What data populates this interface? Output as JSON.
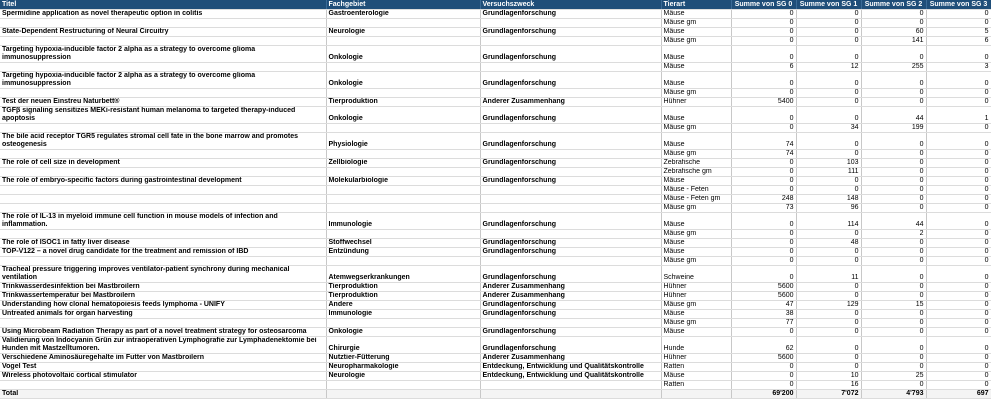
{
  "headers": [
    "Titel",
    "Fachgebiet",
    "Versuchszweck",
    "Tierart",
    "Summe von SG 0",
    "Summe von SG 1",
    "Summe von SG 2",
    "Summe von SG 3"
  ],
  "rows": [
    {
      "titel": "Spermidine application as novel therapeutic option in colitis",
      "fach": "Gastroenterologie",
      "zweck": "Grundlagenforschung",
      "tier": "Mäuse",
      "sg0": "0",
      "sg1": "0",
      "sg2": "0",
      "sg3": "0"
    },
    {
      "titel": "",
      "fach": "",
      "zweck": "",
      "tier": "Mäuse gm",
      "sg0": "0",
      "sg1": "0",
      "sg2": "0",
      "sg3": "0"
    },
    {
      "titel": "State-Dependent Restructuring of Neural Circuitry",
      "fach": "Neurologie",
      "zweck": "Grundlagenforschung",
      "tier": "Mäuse",
      "sg0": "0",
      "sg1": "0",
      "sg2": "60",
      "sg3": "5"
    },
    {
      "titel": "",
      "fach": "",
      "zweck": "",
      "tier": "Mäuse gm",
      "sg0": "0",
      "sg1": "0",
      "sg2": "141",
      "sg3": "6"
    },
    {
      "titel": "Targeting hypoxia-inducible factor 2 alpha as a strategy to overcome glioma immunosuppression",
      "fach": "Onkologie",
      "zweck": "Grundlagenforschung",
      "tier": "Mäuse",
      "sg0": "0",
      "sg1": "0",
      "sg2": "0",
      "sg3": "0"
    },
    {
      "titel": "",
      "fach": "",
      "zweck": "",
      "tier": "Mäuse",
      "sg0": "6",
      "sg1": "12",
      "sg2": "255",
      "sg3": "3"
    },
    {
      "titel": "Targeting hypoxia-inducible factor 2 alpha as a strategy to overcome glioma immunosuppression",
      "fach": "Onkologie",
      "zweck": "Grundlagenforschung",
      "tier": "Mäuse",
      "sg0": "0",
      "sg1": "0",
      "sg2": "0",
      "sg3": "0"
    },
    {
      "titel": "",
      "fach": "",
      "zweck": "",
      "tier": "Mäuse gm",
      "sg0": "0",
      "sg1": "0",
      "sg2": "0",
      "sg3": "0"
    },
    {
      "titel": "Test der neuen Einstreu Naturbett®",
      "fach": "Tierproduktion",
      "zweck": "Anderer Zusammenhang",
      "tier": "Hühner",
      "sg0": "5400",
      "sg1": "0",
      "sg2": "0",
      "sg3": "0"
    },
    {
      "titel": "TGFβ signaling sensitizes MEKi-resistant human melanoma to targeted therapy-induced apoptosis",
      "fach": "Onkologie",
      "zweck": "Grundlagenforschung",
      "tier": "Mäuse",
      "sg0": "0",
      "sg1": "0",
      "sg2": "44",
      "sg3": "1"
    },
    {
      "titel": "",
      "fach": "",
      "zweck": "",
      "tier": "Mäuse gm",
      "sg0": "0",
      "sg1": "34",
      "sg2": "199",
      "sg3": "0"
    },
    {
      "titel": "The bile acid receptor TGR5 regulates stromal cell fate in the bone marrow and promotes osteogenesis",
      "fach": "Physiologie",
      "zweck": "Grundlagenforschung",
      "tier": "Mäuse",
      "sg0": "74",
      "sg1": "0",
      "sg2": "0",
      "sg3": "0"
    },
    {
      "titel": "",
      "fach": "",
      "zweck": "",
      "tier": "Mäuse gm",
      "sg0": "74",
      "sg1": "0",
      "sg2": "0",
      "sg3": "0"
    },
    {
      "titel": "The role of cell size in development",
      "fach": "Zellbiologie",
      "zweck": "Grundlagenforschung",
      "tier": "Zebrafische",
      "sg0": "0",
      "sg1": "103",
      "sg2": "0",
      "sg3": "0"
    },
    {
      "titel": "",
      "fach": "",
      "zweck": "",
      "tier": "Zebrafische gm",
      "sg0": "0",
      "sg1": "111",
      "sg2": "0",
      "sg3": "0"
    },
    {
      "titel": "The role of embryo-specific factors during gastrointestinal development",
      "fach": "Molekularbiologie",
      "zweck": "Grundlagenforschung",
      "tier": "Mäuse",
      "sg0": "0",
      "sg1": "0",
      "sg2": "0",
      "sg3": "0"
    },
    {
      "titel": "",
      "fach": "",
      "zweck": "",
      "tier": "Mäuse - Feten",
      "sg0": "0",
      "sg1": "0",
      "sg2": "0",
      "sg3": "0"
    },
    {
      "titel": "",
      "fach": "",
      "zweck": "",
      "tier": "Mäuse - Feten gm",
      "sg0": "248",
      "sg1": "148",
      "sg2": "0",
      "sg3": "0"
    },
    {
      "titel": "",
      "fach": "",
      "zweck": "",
      "tier": "Mäuse gm",
      "sg0": "73",
      "sg1": "96",
      "sg2": "0",
      "sg3": "0"
    },
    {
      "titel": "The role of IL-13 in myeloid immune cell function in mouse models of infection and inflammation.",
      "fach": "Immunologie",
      "zweck": "Grundlagenforschung",
      "tier": "Mäuse",
      "sg0": "0",
      "sg1": "114",
      "sg2": "44",
      "sg3": "0"
    },
    {
      "titel": "",
      "fach": "",
      "zweck": "",
      "tier": "Mäuse gm",
      "sg0": "0",
      "sg1": "0",
      "sg2": "2",
      "sg3": "0"
    },
    {
      "titel": "The role of ISOC1 in fatty liver disease",
      "fach": "Stoffwechsel",
      "zweck": "Grundlagenforschung",
      "tier": "Mäuse",
      "sg0": "0",
      "sg1": "48",
      "sg2": "0",
      "sg3": "0"
    },
    {
      "titel": "TOP-V122 – a novel drug candidate for the treatment and remission of IBD",
      "fach": "Entzündung",
      "zweck": "Grundlagenforschung",
      "tier": "Mäuse",
      "sg0": "0",
      "sg1": "0",
      "sg2": "0",
      "sg3": "0"
    },
    {
      "titel": "",
      "fach": "",
      "zweck": "",
      "tier": "Mäuse gm",
      "sg0": "0",
      "sg1": "0",
      "sg2": "0",
      "sg3": "0"
    },
    {
      "titel": "Tracheal pressure triggering improves  ventilator-patient synchrony during mechanical ventilation",
      "fach": "Atemwegserkrankungen",
      "zweck": "Grundlagenforschung",
      "tier": "Schweine",
      "sg0": "0",
      "sg1": "11",
      "sg2": "0",
      "sg3": "0"
    },
    {
      "titel": "Trinkwasserdesinfektion bei Mastbroilern",
      "fach": "Tierproduktion",
      "zweck": "Anderer Zusammenhang",
      "tier": "Hühner",
      "sg0": "5600",
      "sg1": "0",
      "sg2": "0",
      "sg3": "0"
    },
    {
      "titel": "Trinkwassertemperatur bei Mastbroilern",
      "fach": "Tierproduktion",
      "zweck": "Anderer Zusammenhang",
      "tier": "Hühner",
      "sg0": "5600",
      "sg1": "0",
      "sg2": "0",
      "sg3": "0"
    },
    {
      "titel": "Understanding how clonal hematopoiesis feeds lymphoma - UNIFY",
      "fach": "Andere",
      "zweck": "Grundlagenforschung",
      "tier": "Mäuse gm",
      "sg0": "47",
      "sg1": "129",
      "sg2": "15",
      "sg3": "0"
    },
    {
      "titel": "Untreated animals for organ harvesting",
      "fach": "Immunologie",
      "zweck": "Grundlagenforschung",
      "tier": "Mäuse",
      "sg0": "38",
      "sg1": "0",
      "sg2": "0",
      "sg3": "0"
    },
    {
      "titel": "",
      "fach": "",
      "zweck": "",
      "tier": "Mäuse gm",
      "sg0": "77",
      "sg1": "0",
      "sg2": "0",
      "sg3": "0"
    },
    {
      "titel": "Using Microbeam Radiation Therapy as part of a novel treatment strategy for osteosarcoma",
      "fach": "Onkologie",
      "zweck": "Grundlagenforschung",
      "tier": "Mäuse",
      "sg0": "0",
      "sg1": "0",
      "sg2": "0",
      "sg3": "0"
    },
    {
      "titel": "Validierung von Indocyanin Grün zur intraoperativen Lymphografie zur Lymphadenektomie bei Hunden mit Mastzelltumoren.",
      "fach": "Chirurgie",
      "zweck": "Grundlagenforschung",
      "tier": "Hunde",
      "sg0": "62",
      "sg1": "0",
      "sg2": "0",
      "sg3": "0"
    },
    {
      "titel": "Verschiedene Aminosäuregehalte im Futter von Mastbroilern",
      "fach": "Nutztier-Fütterung",
      "zweck": "Anderer Zusammenhang",
      "tier": "Hühner",
      "sg0": "5600",
      "sg1": "0",
      "sg2": "0",
      "sg3": "0"
    },
    {
      "titel": "Vogel Test",
      "fach": "Neuropharmakologie",
      "zweck": "Entdeckung, Entwicklung und Qualitätskontrolle",
      "tier": "Ratten",
      "sg0": "0",
      "sg1": "0",
      "sg2": "0",
      "sg3": "0"
    },
    {
      "titel": "Wireless photovoltaic cortical stimulator",
      "fach": "Neurologie",
      "zweck": "Entdeckung, Entwicklung und Qualitätskontrolle",
      "tier": "Mäuse",
      "sg0": "0",
      "sg1": "10",
      "sg2": "25",
      "sg3": "0"
    },
    {
      "titel": "",
      "fach": "",
      "zweck": "",
      "tier": "Ratten",
      "sg0": "0",
      "sg1": "16",
      "sg2": "0",
      "sg3": "0"
    }
  ],
  "total": {
    "label": "Total",
    "sg0": "69'200",
    "sg1": "7'072",
    "sg2": "4'793",
    "sg3": "697"
  }
}
